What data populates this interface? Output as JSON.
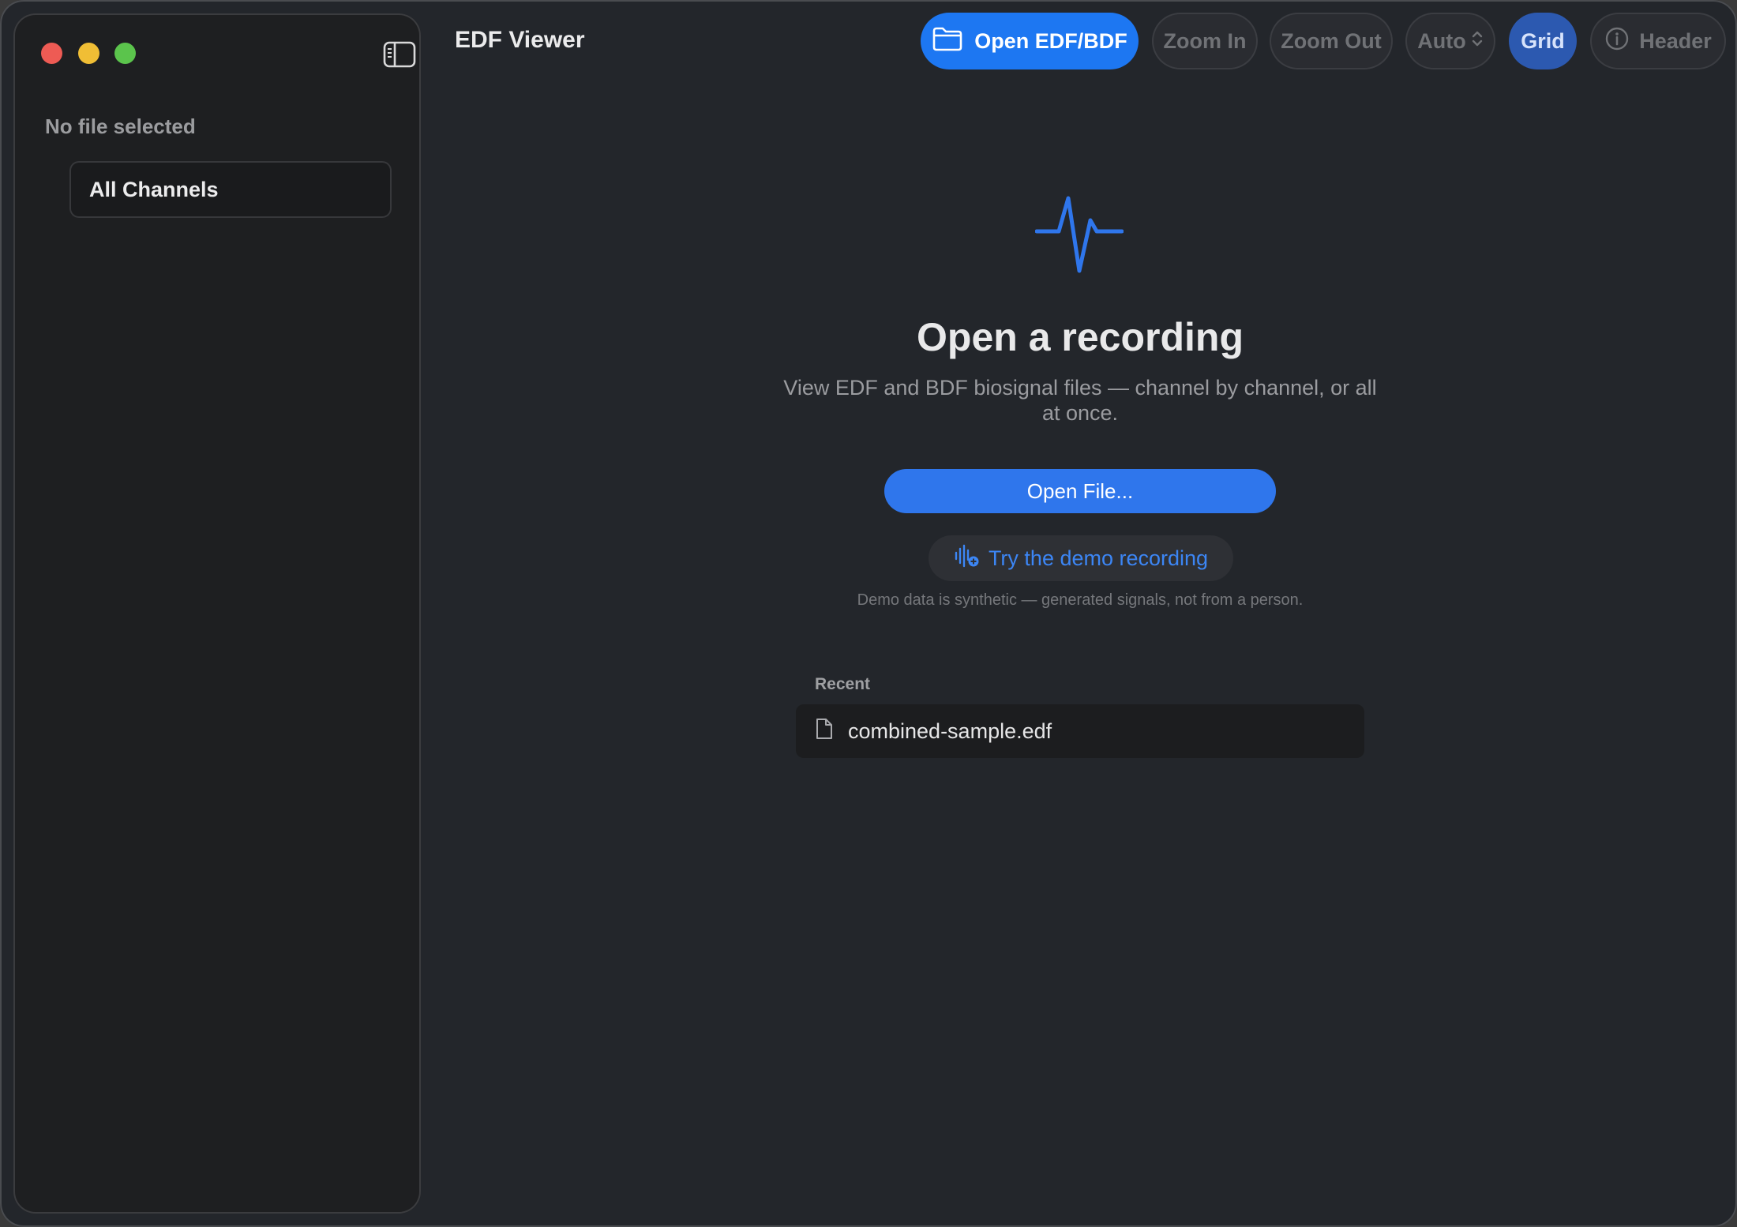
{
  "sidebar": {
    "file_status": "No file selected",
    "channels": [
      {
        "label": "All Channels"
      }
    ]
  },
  "toolbar": {
    "app_title": "EDF Viewer",
    "open_label": "Open EDF/BDF",
    "zoom_in_label": "Zoom In",
    "zoom_out_label": "Zoom Out",
    "scale_label": "Auto",
    "grid_label": "Grid",
    "header_label": "Header"
  },
  "main": {
    "icon": "waveform-pulse-icon",
    "headline": "Open a recording",
    "subtitle": "View EDF and BDF biosignal files — channel by channel, or all at once.",
    "open_file_label": "Open File...",
    "demo_label": "Try the demo recording",
    "demo_note": "Demo data is synthetic — generated signals, not from a person.",
    "recent_heading": "Recent",
    "recent_files": [
      {
        "name": "combined-sample.edf",
        "icon": "document-icon"
      }
    ]
  },
  "colors": {
    "accent": "#1d77f2",
    "window_bg": "#23262b",
    "sidebar_bg": "#1e1f21",
    "grid_active": "#2c59b0"
  }
}
